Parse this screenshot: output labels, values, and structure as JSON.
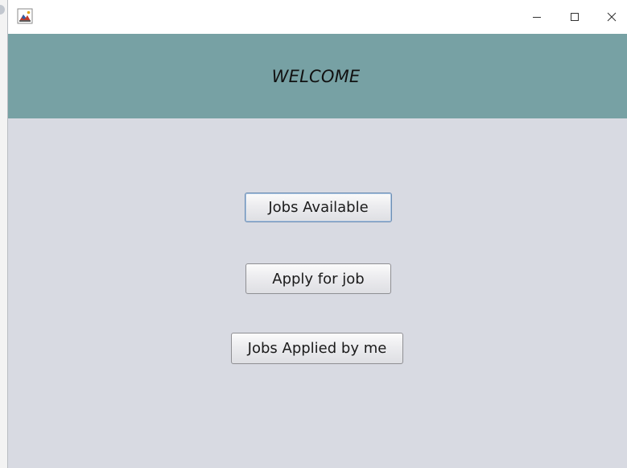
{
  "window": {
    "icon": "java-app-icon",
    "controls": {
      "minimize": "minimize-icon",
      "maximize": "maximize-icon",
      "close": "close-icon"
    }
  },
  "header": {
    "title": "WELCOME",
    "background": "#77a1a4"
  },
  "main": {
    "background": "#d8dae2",
    "buttons": {
      "jobs_available": "Jobs Available",
      "apply_for_job": "Apply for job",
      "jobs_applied": "Jobs Applied by me"
    }
  }
}
